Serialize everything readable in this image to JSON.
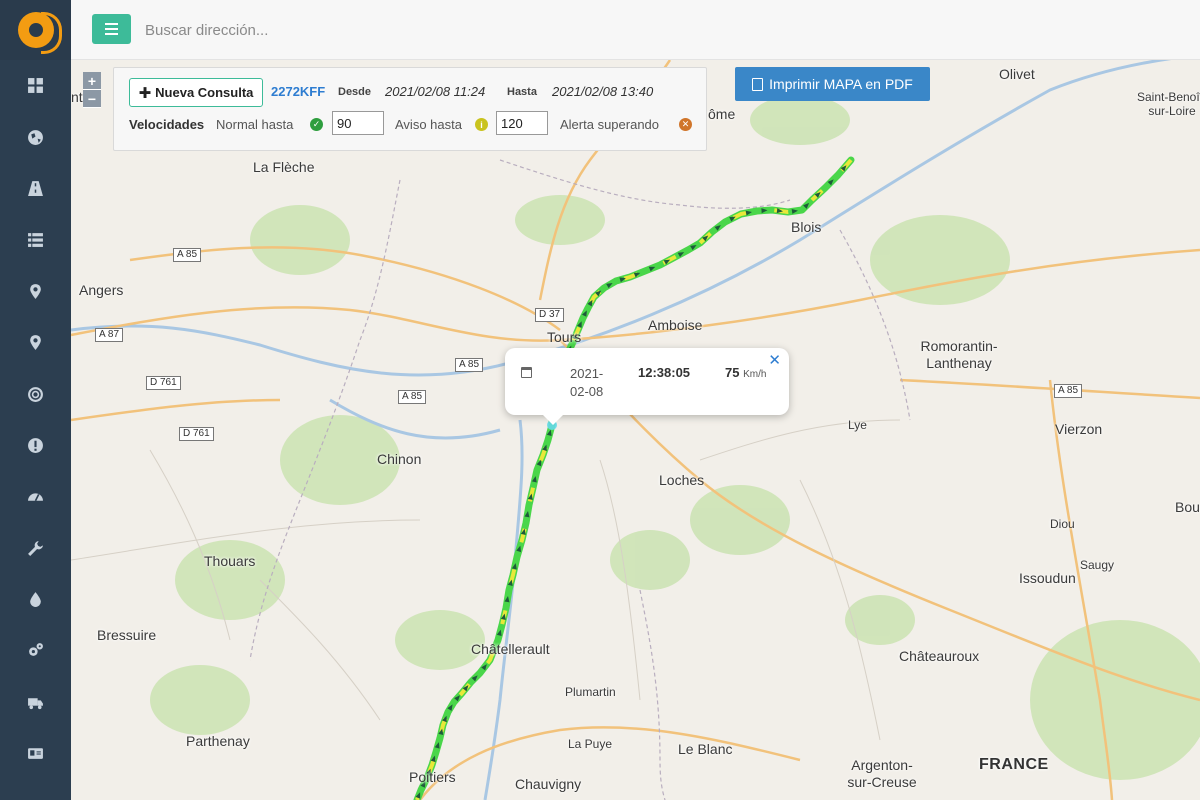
{
  "topbar": {
    "search_placeholder": "Buscar dirección..."
  },
  "sidebar": {
    "items": [
      {
        "icon": "dashboard-icon"
      },
      {
        "icon": "globe-icon"
      },
      {
        "icon": "road-icon"
      },
      {
        "icon": "list-icon"
      },
      {
        "icon": "map-marker-icon"
      },
      {
        "icon": "map-pin-icon"
      },
      {
        "icon": "target-icon"
      },
      {
        "icon": "alert-icon"
      },
      {
        "icon": "speedometer-icon"
      },
      {
        "icon": "wrench-icon"
      },
      {
        "icon": "fuel-drop-icon"
      },
      {
        "icon": "settings-cogs-icon"
      },
      {
        "icon": "truck-icon"
      },
      {
        "icon": "id-card-icon"
      },
      {
        "icon": "card-icon"
      }
    ]
  },
  "query": {
    "new_button": "Nueva Consulta",
    "plate": "2272KFF",
    "from_label": "Desde",
    "from_value": "2021/02/08 11:24",
    "to_label": "Hasta",
    "to_value": "2021/02/08 13:40",
    "speeds_label": "Velocidades",
    "normal_label": "Normal hasta",
    "normal_value": "90",
    "warning_label": "Aviso hasta",
    "warning_value": "120",
    "alert_label": "Alerta superando",
    "colors": {
      "normal": "#2e9e3e",
      "warning": "#c9c31e",
      "alert": "#d0752a"
    }
  },
  "pdf_button": "Imprimir MAPA en PDF",
  "popup": {
    "date": "2021-02-08",
    "time": "12:38:05",
    "speed": "75",
    "unit": "Km/h"
  },
  "zoom": {
    "in": "+",
    "out": "−"
  },
  "map": {
    "places": [
      "Olivet",
      "Saint-Benoît-sur-Loire",
      "La Flèche",
      "Blois",
      "Angers",
      "Tours",
      "Amboise",
      "Romorantin-Lanthenay",
      "Chinon",
      "Loches",
      "Lye",
      "Vierzon",
      "Thouars",
      "Diou",
      "Saugy",
      "Issoudun",
      "Bressuire",
      "Châtellerault",
      "Châteauroux",
      "Plumartin",
      "Parthenay",
      "La Puye",
      "Le Blanc",
      "Poitiers",
      "Chauvigny",
      "Argenton-sur-Creuse",
      "FRANCE",
      "Bou",
      "ôme",
      "ntier"
    ],
    "roads": [
      "A 85",
      "A 87",
      "D 761",
      "D 761",
      "D 37",
      "A 85",
      "A 85",
      "A 85"
    ]
  }
}
